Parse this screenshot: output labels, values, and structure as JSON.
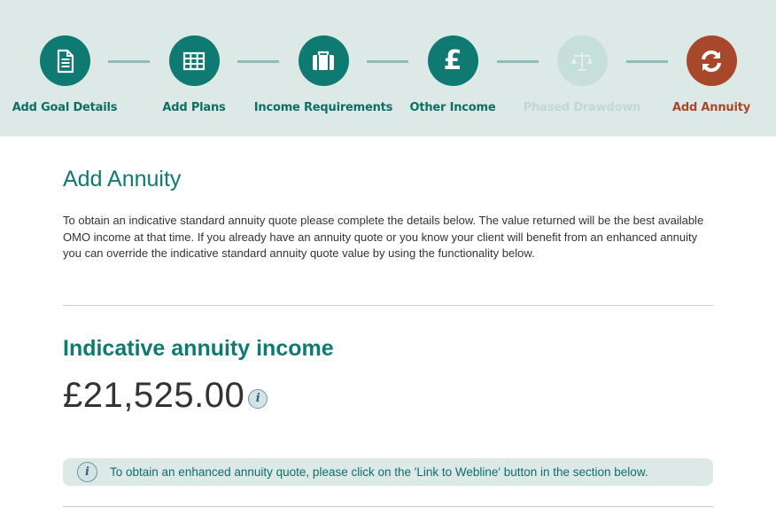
{
  "stepper": {
    "steps": [
      {
        "label": "Add Goal Details",
        "icon": "document-icon",
        "state": "completed"
      },
      {
        "label": "Add Plans",
        "icon": "table-icon",
        "state": "completed"
      },
      {
        "label": "Income Requirements",
        "icon": "briefcase-icon",
        "state": "completed"
      },
      {
        "label": "Other Income",
        "icon": "pound-icon",
        "state": "completed"
      },
      {
        "label": "Phased Drawdown",
        "icon": "scales-icon",
        "state": "disabled"
      },
      {
        "label": "Add Annuity",
        "icon": "refresh-icon",
        "state": "active"
      }
    ]
  },
  "main": {
    "title": "Add Annuity",
    "intro": "To obtain an indicative standard annuity quote please complete the details below. The value returned will be the best available OMO income at that time. If you already have an annuity quote or you know your client will benefit from an enhanced annuity you can override the indicative standard annuity quote value by using the functionality below.",
    "section_title": "Indicative annuity income",
    "amount": "£21,525.00",
    "info_glyph": "i",
    "notice": "To obtain an enhanced annuity quote, please click on the 'Link to Webline' button in the section below."
  },
  "colors": {
    "primary": "#0e7a72",
    "active": "#a8482a",
    "disabled": "#c7dfdb",
    "band": "#dde9e6"
  }
}
